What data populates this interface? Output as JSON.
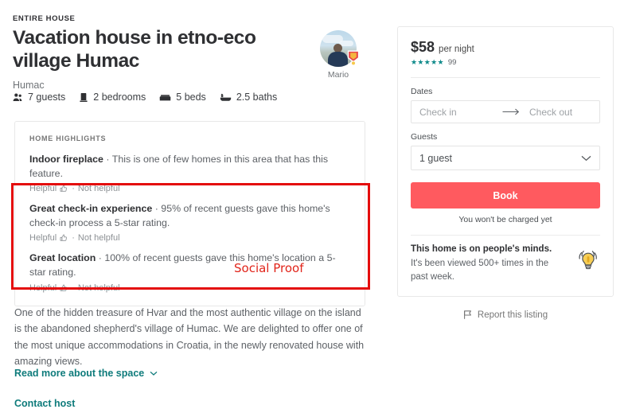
{
  "listing": {
    "kicker": "ENTIRE HOUSE",
    "title": "Vacation house in etno-eco village Humac",
    "locality": "Humac",
    "facts": [
      {
        "icon": "guests-icon",
        "label": "7 guests"
      },
      {
        "icon": "bedrooms-icon",
        "label": "2 bedrooms"
      },
      {
        "icon": "beds-icon",
        "label": "5 beds"
      },
      {
        "icon": "baths-icon",
        "label": "2.5 baths"
      }
    ]
  },
  "host": {
    "name": "Mario",
    "badge": "superhost-badge-icon",
    "avatar": "host-avatar"
  },
  "highlights": {
    "kicker": "HOME HIGHLIGHTS",
    "helpful_label": "Helpful",
    "separator": "·",
    "not_helpful_label": "Not helpful",
    "items": [
      {
        "title": "Indoor fireplace",
        "sep": " · ",
        "detail": "This is one of few homes in this area that has this feature."
      },
      {
        "title": "Great check-in experience",
        "sep": " · ",
        "detail": "95% of recent guests gave this home's check-in process a 5-star rating."
      },
      {
        "title": "Great location",
        "sep": " · ",
        "detail": "100% of recent guests gave this home's location a 5-star rating."
      }
    ]
  },
  "annotation": {
    "label": "Social Proof",
    "color": "#e1251b",
    "box_color": "#e40c0c"
  },
  "description": {
    "body": "One of the hidden treasure of Hvar and the most authentic village on the island is the abandoned shepherd's village of Humac. We are delighted to offer one of the most unique accommodations in Croatia, in the newly renovated house with amazing views.",
    "read_more_label": "Read more about the space",
    "contact_host_label": "Contact host",
    "link_color": "#0e7b7b"
  },
  "booking": {
    "price": "$58",
    "price_unit": "per night",
    "stars": "★★★★★",
    "star_color": "#0f8a8a",
    "rating_count": "99",
    "dates_label": "Dates",
    "check_in_placeholder": "Check in",
    "check_out_placeholder": "Check out",
    "guests_label": "Guests",
    "guests_value": "1 guest",
    "book_label": "Book",
    "book_color": "#ff5a5f",
    "charge_note": "You won't be charged yet",
    "minds_title": "This home is on people's minds.",
    "minds_sub": "It's been viewed 500+ times in the past week.",
    "report_label": "Report this listing"
  }
}
